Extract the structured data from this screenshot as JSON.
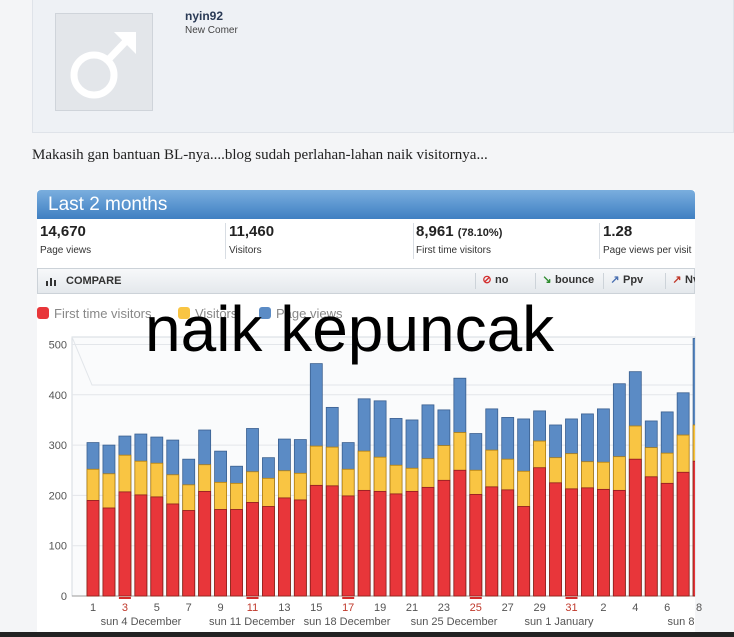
{
  "user": {
    "name": "nyin92",
    "title": "New Comer",
    "avatar_icon": "male-symbol-icon"
  },
  "post": {
    "message": "Makasih gan bantuan BL-nya....blog sudah perlahan-lahan naik visitornya..."
  },
  "stats_panel": {
    "title": "Last 2 months",
    "stats": [
      {
        "value": "14,670",
        "pct": "",
        "label": "Page views"
      },
      {
        "value": "11,460",
        "pct": "",
        "label": "Visitors"
      },
      {
        "value": "8,961",
        "pct": "(78.10%)",
        "label": "First time visitors"
      },
      {
        "value": "1.28",
        "pct": "",
        "label": "Page views per visit"
      }
    ],
    "compare": {
      "label": "COMPARE",
      "buttons": [
        {
          "label": "no",
          "icon": "no-entry-icon",
          "color": "#d32f2f"
        },
        {
          "label": "bounce",
          "icon": "bounce-arrow-icon",
          "color": "#2e8b2e"
        },
        {
          "label": "Ppv",
          "icon": "line-chart-icon",
          "color": "#4a6fb0"
        },
        {
          "label": "Nv",
          "icon": "line-chart-icon",
          "color": "#c0392b"
        }
      ]
    }
  },
  "overlay_text": "naik kepuncak",
  "chart_data": {
    "type": "bar",
    "stacked": true,
    "legend": "top-left",
    "grid": true,
    "ylim": [
      0,
      500
    ],
    "yticks": [
      0,
      100,
      200,
      300,
      400,
      500
    ],
    "x": [
      1,
      2,
      3,
      4,
      5,
      6,
      7,
      8,
      9,
      10,
      11,
      12,
      13,
      14,
      15,
      16,
      17,
      18,
      19,
      20,
      21,
      22,
      23,
      24,
      25,
      26,
      27,
      28,
      29,
      30,
      31,
      32,
      33,
      34,
      35,
      36,
      37,
      38,
      39
    ],
    "xtick_labels": [
      "1",
      "3",
      "5",
      "7",
      "9",
      "11",
      "13",
      "15",
      "17",
      "19",
      "21",
      "23",
      "25",
      "27",
      "29",
      "31",
      "2",
      "4",
      "6",
      "8"
    ],
    "weekend_ticks": [
      "3",
      "11",
      "17",
      "25",
      "31"
    ],
    "week_labels": [
      "sun 4 December",
      "sun 11 December",
      "sun 18 December",
      "sun 25 December",
      "sun 1 January",
      "sun 8"
    ],
    "series": [
      {
        "name": "First time visitors",
        "color": "#e8363a",
        "values": [
          190,
          175,
          207,
          201,
          197,
          183,
          170,
          208,
          172,
          172,
          186,
          178,
          195,
          191,
          220,
          219,
          199,
          210,
          208,
          203,
          208,
          216,
          230,
          250,
          202,
          217,
          211,
          178,
          255,
          225,
          213,
          215,
          212,
          210,
          272,
          237,
          224,
          246,
          268
        ]
      },
      {
        "name": "Visitors",
        "color": "#f9c543",
        "values": [
          252,
          243,
          280,
          268,
          264,
          241,
          221,
          261,
          226,
          224,
          247,
          234,
          249,
          244,
          298,
          296,
          252,
          288,
          276,
          260,
          254,
          273,
          299,
          325,
          250,
          290,
          272,
          248,
          308,
          275,
          283,
          267,
          266,
          277,
          338,
          295,
          284,
          320,
          340
        ]
      },
      {
        "name": "Page views",
        "color": "#5b8bc5",
        "values": [
          305,
          300,
          318,
          322,
          316,
          310,
          272,
          330,
          288,
          258,
          333,
          275,
          312,
          311,
          462,
          375,
          305,
          392,
          388,
          353,
          350,
          380,
          370,
          433,
          323,
          372,
          355,
          352,
          368,
          340,
          352,
          362,
          372,
          422,
          446,
          348,
          366,
          404,
          512
        ]
      }
    ]
  }
}
